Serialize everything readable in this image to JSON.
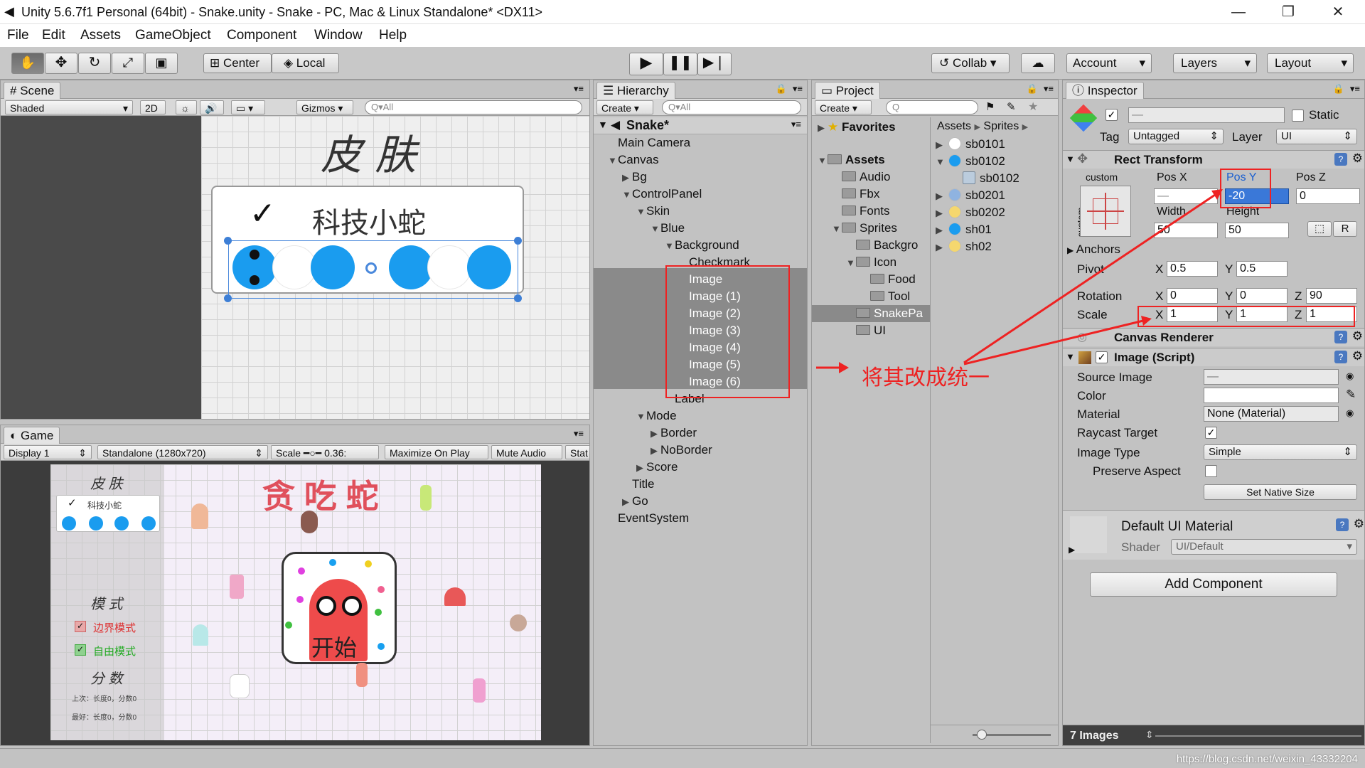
{
  "window": {
    "title": "Unity 5.6.7f1 Personal (64bit) - Snake.unity - Snake - PC, Mac & Linux Standalone* <DX11>"
  },
  "menu": [
    "File",
    "Edit",
    "Assets",
    "GameObject",
    "Component",
    "Window",
    "Help"
  ],
  "toolbar": {
    "center": "Center",
    "local": "Local",
    "collab": "Collab",
    "account": "Account",
    "layers": "Layers",
    "layout": "Layout"
  },
  "scene": {
    "tab": "Scene",
    "shading": "Shaded",
    "mode2d": "2D",
    "gizmos": "Gizmos",
    "search": "All",
    "title_text": "皮 肤",
    "skin_label": "科技小蛇"
  },
  "game": {
    "tab": "Game",
    "display": "Display 1",
    "resolution": "Standalone (1280x720)",
    "scale_label": "Scale",
    "scale_value": "0.36:",
    "maximize": "Maximize On Play",
    "mute": "Mute Audio",
    "stats": "Stat",
    "game_title": "贪 吃 蛇",
    "skin": "皮 肤",
    "skin_item": "科技小蛇",
    "mode": "模 式",
    "border_mode": "边界模式",
    "free_mode": "自由模式",
    "score": "分 数",
    "score_line1": "上次：长度0，分数0",
    "score_line2": "最好：长度0，分数0",
    "start": "开始"
  },
  "hierarchy": {
    "tab": "Hierarchy",
    "create": "Create",
    "search": "All",
    "scene_name": "Snake*",
    "items": [
      {
        "label": "Main Camera",
        "indent": 0,
        "arrow": ""
      },
      {
        "label": "Canvas",
        "indent": 0,
        "arrow": "▼"
      },
      {
        "label": "Bg",
        "indent": 1,
        "arrow": "▶"
      },
      {
        "label": "ControlPanel",
        "indent": 1,
        "arrow": "▼"
      },
      {
        "label": "Skin",
        "indent": 2,
        "arrow": "▼"
      },
      {
        "label": "Blue",
        "indent": 3,
        "arrow": "▼"
      },
      {
        "label": "Background",
        "indent": 4,
        "arrow": "▼"
      },
      {
        "label": "Checkmark",
        "indent": 5,
        "arrow": ""
      },
      {
        "label": "Image",
        "indent": 5,
        "arrow": "",
        "sel": true
      },
      {
        "label": "Image (1)",
        "indent": 5,
        "arrow": "",
        "sel": true
      },
      {
        "label": "Image (2)",
        "indent": 5,
        "arrow": "",
        "sel": true
      },
      {
        "label": "Image (3)",
        "indent": 5,
        "arrow": "",
        "sel": true
      },
      {
        "label": "Image (4)",
        "indent": 5,
        "arrow": "",
        "sel": true
      },
      {
        "label": "Image (5)",
        "indent": 5,
        "arrow": "",
        "sel": true
      },
      {
        "label": "Image (6)",
        "indent": 5,
        "arrow": "",
        "sel": true
      },
      {
        "label": "Label",
        "indent": 4,
        "arrow": ""
      },
      {
        "label": "Mode",
        "indent": 2,
        "arrow": "▼"
      },
      {
        "label": "Border",
        "indent": 3,
        "arrow": "▶"
      },
      {
        "label": "NoBorder",
        "indent": 3,
        "arrow": "▶"
      },
      {
        "label": "Score",
        "indent": 2,
        "arrow": "▶"
      },
      {
        "label": "Title",
        "indent": 1,
        "arrow": ""
      },
      {
        "label": "Go",
        "indent": 1,
        "arrow": "▶"
      },
      {
        "label": "EventSystem",
        "indent": 0,
        "arrow": ""
      }
    ]
  },
  "project": {
    "tab": "Project",
    "create": "Create",
    "favorites": "Favorites",
    "assets_root": "Assets",
    "breadcrumb": [
      "Assets",
      "Sprites"
    ],
    "folders": [
      {
        "label": "Audio",
        "indent": 1,
        "arrow": ""
      },
      {
        "label": "Fbx",
        "indent": 1,
        "arrow": ""
      },
      {
        "label": "Fonts",
        "indent": 1,
        "arrow": ""
      },
      {
        "label": "Sprites",
        "indent": 1,
        "arrow": "▼"
      },
      {
        "label": "Backgro",
        "indent": 2,
        "arrow": ""
      },
      {
        "label": "Icon",
        "indent": 2,
        "arrow": "▼"
      },
      {
        "label": "Food",
        "indent": 3,
        "arrow": ""
      },
      {
        "label": "Tool",
        "indent": 3,
        "arrow": ""
      },
      {
        "label": "SnakePa",
        "indent": 2,
        "arrow": "",
        "sel": true
      },
      {
        "label": "UI",
        "indent": 2,
        "arrow": ""
      }
    ],
    "sprites": [
      {
        "label": "sb0101",
        "arrow": "▶",
        "color": "#ffffff"
      },
      {
        "label": "sb0102",
        "arrow": "▼",
        "color": "#1a9cef"
      },
      {
        "label": "sb0102",
        "arrow": "",
        "color": "sub"
      },
      {
        "label": "sb0201",
        "arrow": "▶",
        "color": "#8fb3e0"
      },
      {
        "label": "sb0202",
        "arrow": "▶",
        "color": "#f5d76e"
      },
      {
        "label": "sh01",
        "arrow": "▶",
        "color": "#1a9cef"
      },
      {
        "label": "sh02",
        "arrow": "▶",
        "color": "#f5d76e"
      }
    ]
  },
  "inspector": {
    "tab": "Inspector",
    "static": "Static",
    "tag_label": "Tag",
    "tag_value": "Untagged",
    "layer_label": "Layer",
    "layer_value": "UI",
    "rect": {
      "title": "Rect Transform",
      "custom": "custom",
      "posx_label": "Pos X",
      "posy_label": "Pos Y",
      "posz_label": "Pos Z",
      "posx": "—",
      "posy": "-20",
      "posz": "0",
      "width_label": "Width",
      "height_label": "Height",
      "width": "50",
      "height": "50",
      "anchors": "Anchors",
      "pivot": "Pivot",
      "pivot_x": "0.5",
      "pivot_y": "0.5",
      "rotation": "Rotation",
      "rot_x": "0",
      "rot_y": "0",
      "rot_z": "90",
      "scale": "Scale",
      "scale_x": "1",
      "scale_y": "1",
      "scale_z": "1",
      "x": "X",
      "y": "Y",
      "z": "Z",
      "r": "R"
    },
    "canvas_renderer": "Canvas Renderer",
    "image": {
      "title": "Image (Script)",
      "source_label": "Source Image",
      "source": "—",
      "color_label": "Color",
      "material_label": "Material",
      "material": "None (Material)",
      "raycast": "Raycast Target",
      "type_label": "Image Type",
      "type": "Simple",
      "preserve": "Preserve Aspect",
      "native": "Set Native Size"
    },
    "material": {
      "title": "Default UI Material",
      "shader_label": "Shader",
      "shader": "UI/Default"
    },
    "add_component": "Add Component",
    "footer": "7 Images"
  },
  "annotation": "将其改成统一",
  "watermark": "https://blog.csdn.net/weixin_43332204"
}
